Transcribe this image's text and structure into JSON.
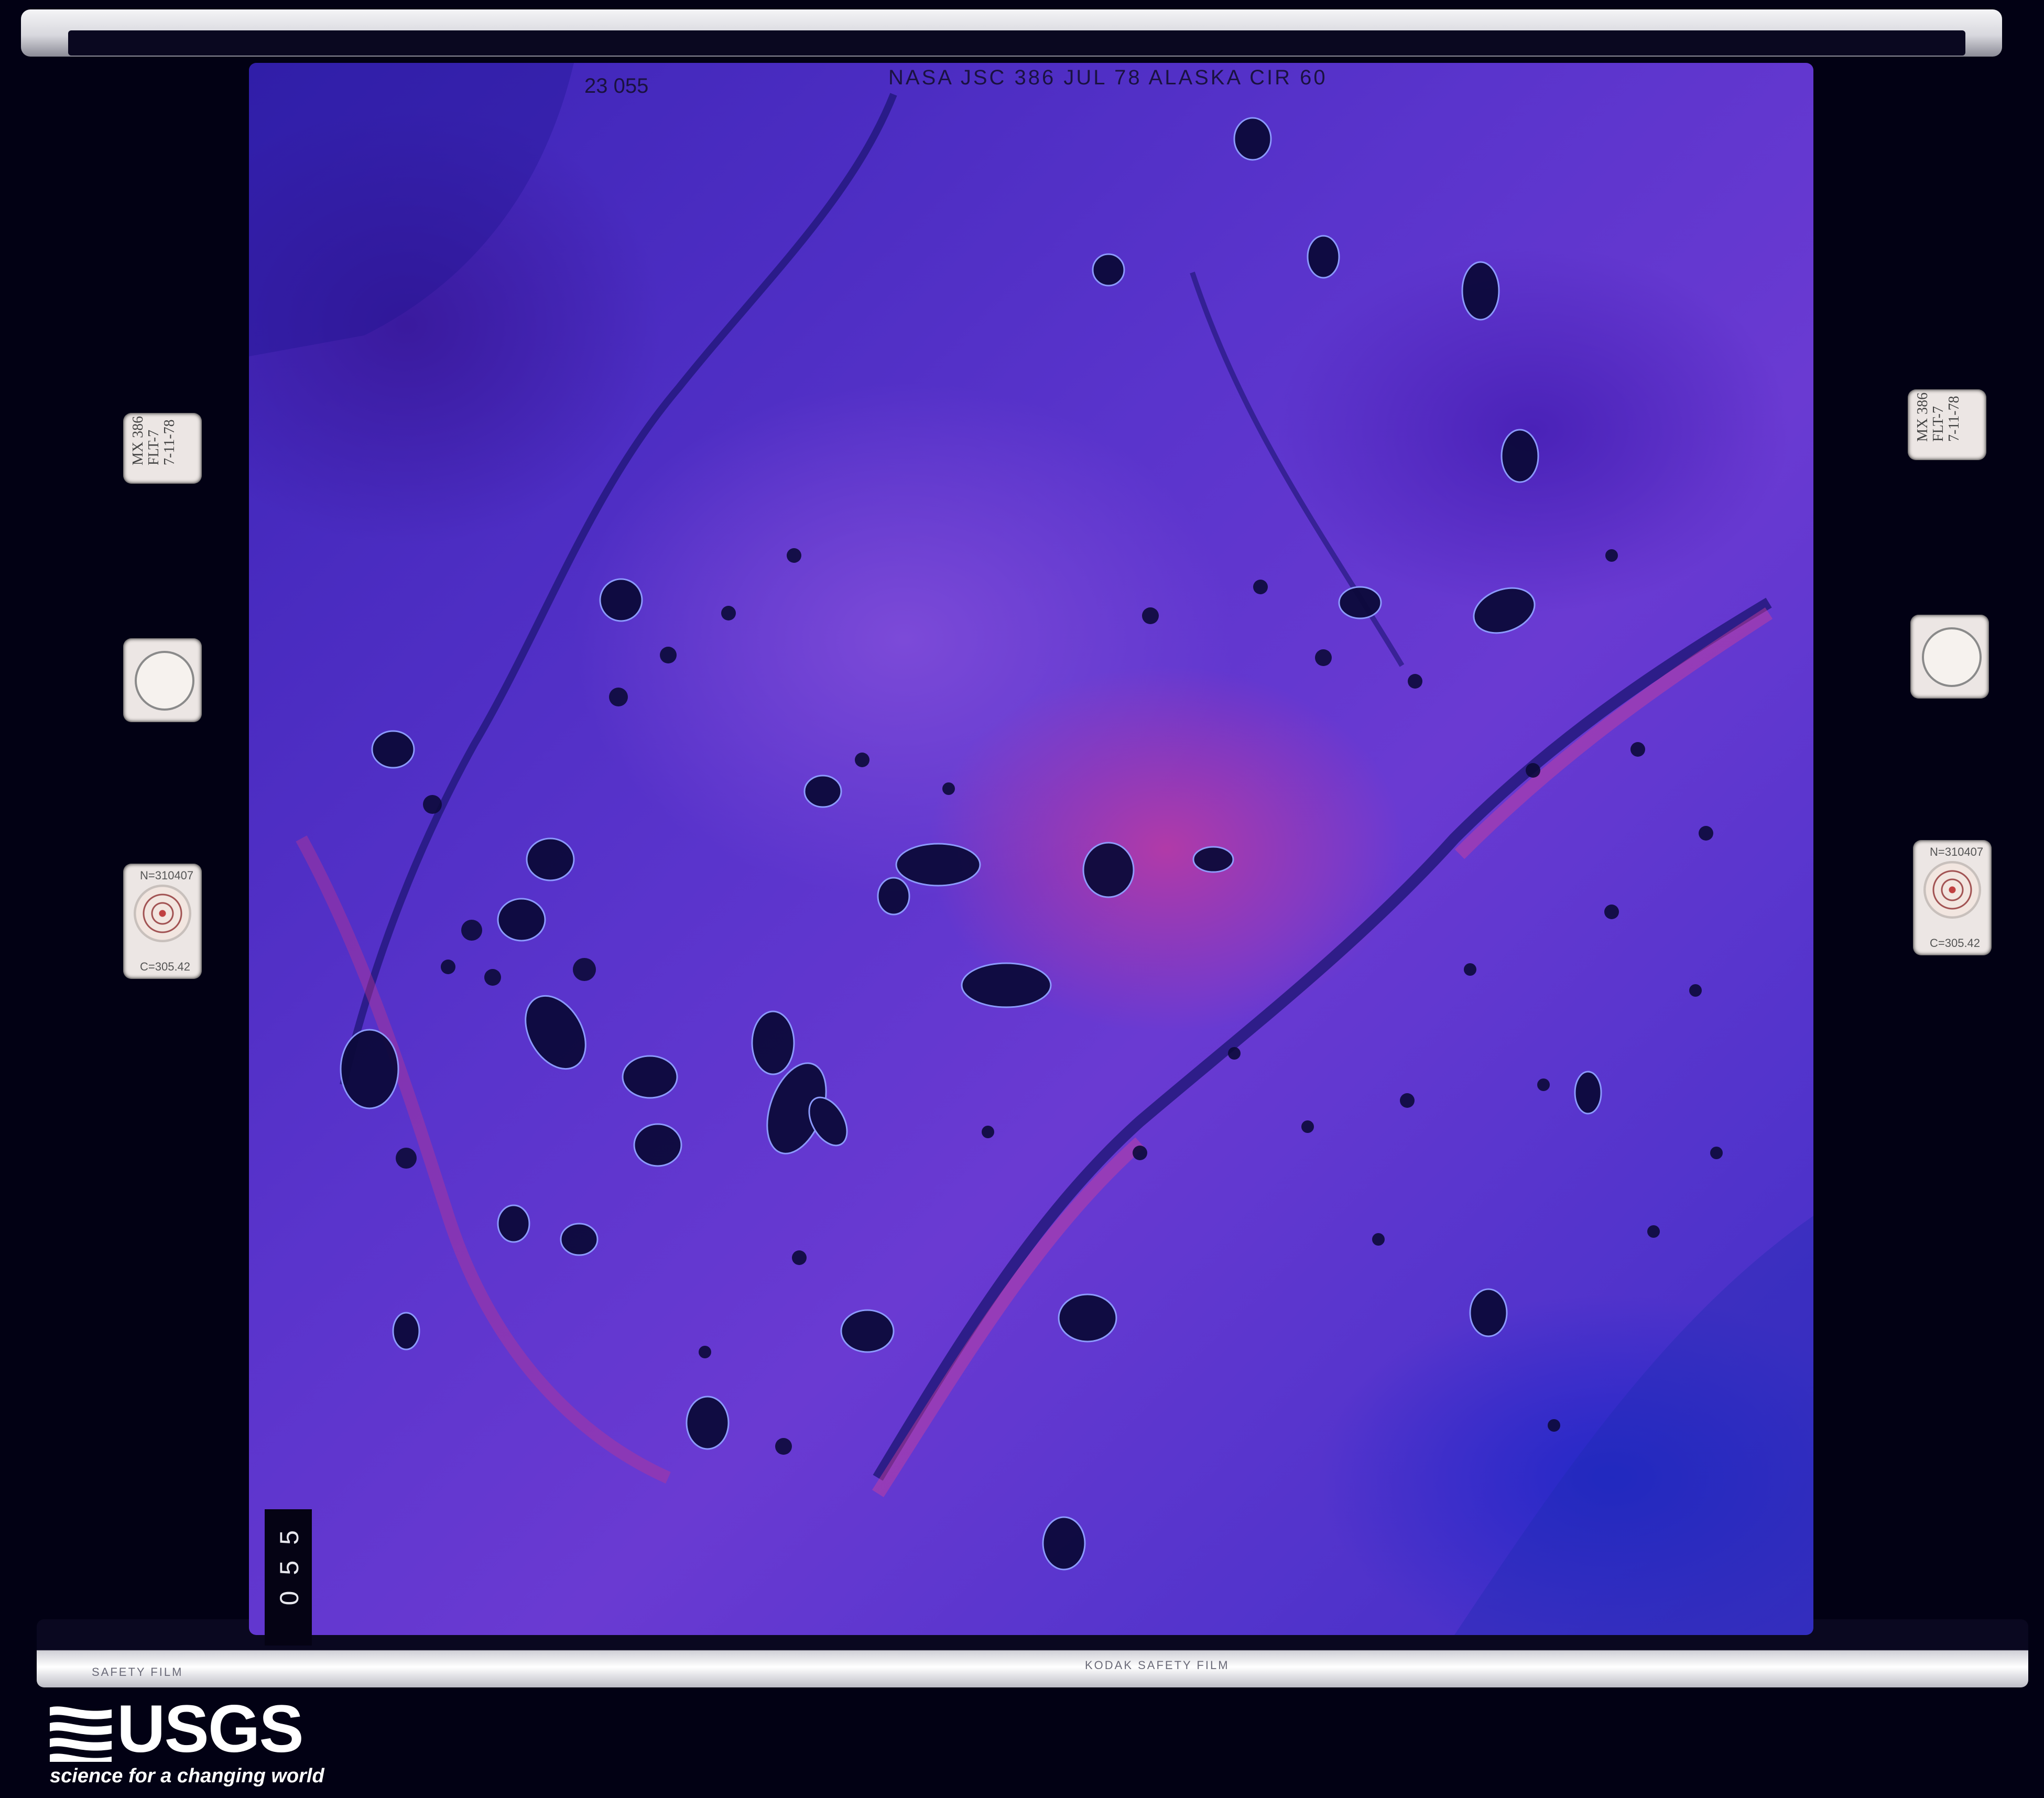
{
  "film": {
    "frame_label": "NASA JSC 386 JUL 78 ALASKA CIR 60",
    "frame_id": "23 055",
    "side_number": "055",
    "bottom_edge_text": "KODAK SAFETY FILM",
    "bottom_edge_text_left": "SAFETY FILM"
  },
  "cards": {
    "note_text": "MX 386\nFLT-7\n7-11-78",
    "target_text": "N=310407",
    "target_text_2": "C=305.42"
  },
  "logo": {
    "name": "USGS",
    "tagline": "science for a changing world"
  },
  "colors": {
    "background": "#020114",
    "terrain_base": "#5a34cc",
    "vegetation_red": "#b13aa8",
    "lakes": "#0c0a3a"
  }
}
